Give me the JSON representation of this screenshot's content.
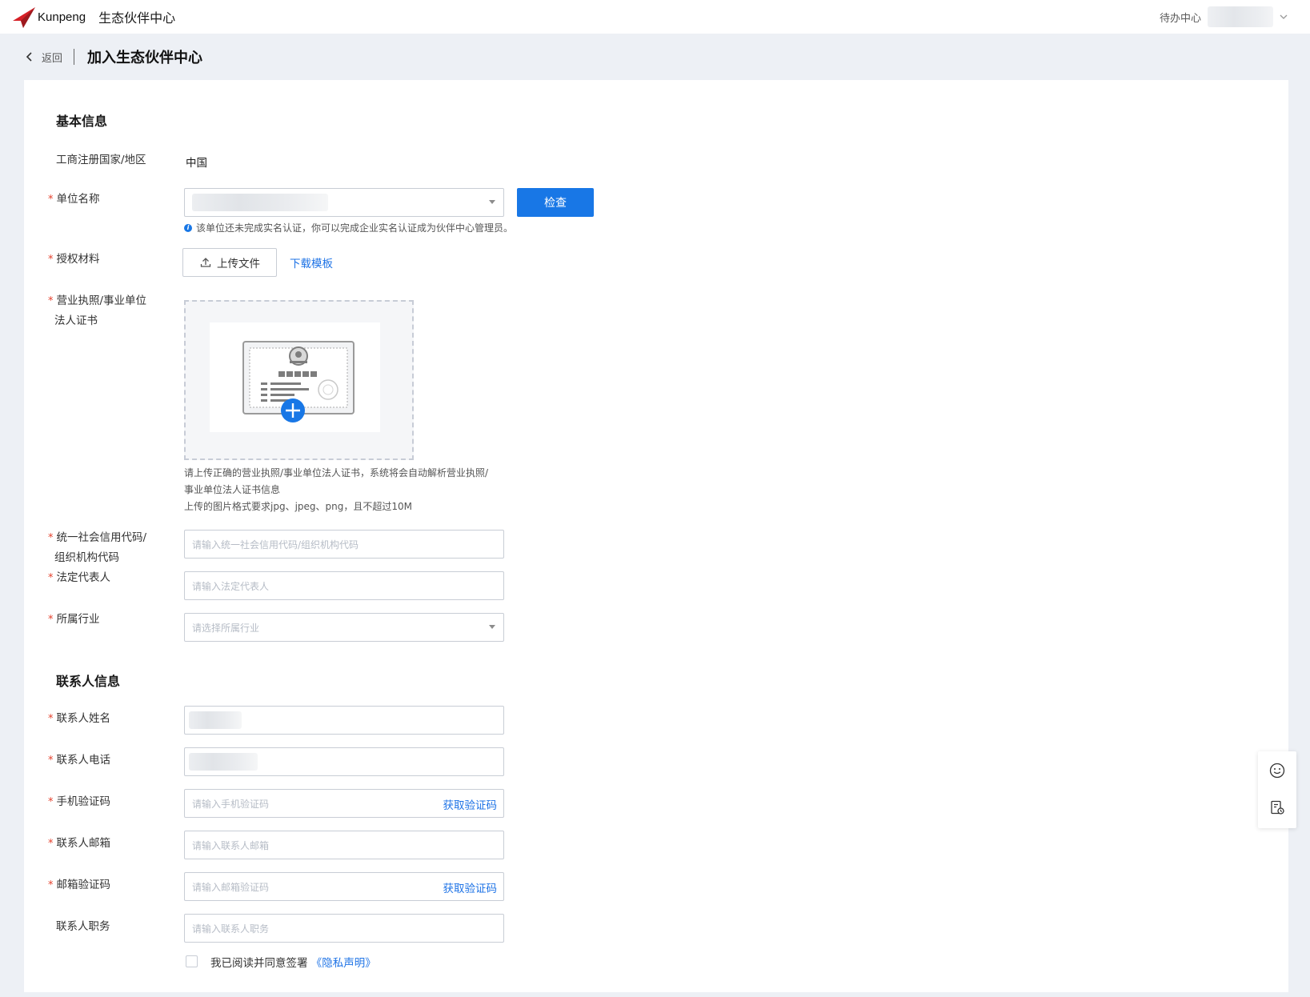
{
  "topbar": {
    "logo_text": "Kunpeng",
    "app_name": "生态伙伴中心",
    "todo": "待办中心"
  },
  "page": {
    "back": "返回",
    "title": "加入生态伙伴中心"
  },
  "basic": {
    "section_title": "基本信息",
    "country": {
      "label": "工商注册国家/地区",
      "value": "中国"
    },
    "unit_name": {
      "label": "单位名称",
      "check_button": "检查",
      "hint": "该单位还未完成实名认证，你可以完成企业实名认证成为伙伴中心管理员。"
    },
    "auth_material": {
      "label": "授权材料",
      "upload_button": "上传文件",
      "download_link": "下载模板"
    },
    "license": {
      "label_line1": "营业执照/事业单位",
      "label_line2": "法人证书",
      "desc_line1": "请上传正确的营业执照/事业单位法人证书，系统将会自动解析营业执照/",
      "desc_line2": "事业单位法人证书信息",
      "desc_line3": "上传的图片格式要求jpg、jpeg、png，且不超过10M"
    },
    "credit_code": {
      "label_line1": "统一社会信用代码/",
      "label_line2": "组织机构代码",
      "placeholder": "请输入统一社会信用代码/组织机构代码"
    },
    "legal_rep": {
      "label": "法定代表人",
      "placeholder": "请输入法定代表人"
    },
    "industry": {
      "label": "所属行业",
      "placeholder": "请选择所属行业"
    }
  },
  "contact": {
    "section_title": "联系人信息",
    "name": {
      "label": "联系人姓名"
    },
    "phone": {
      "label": "联系人电话"
    },
    "sms_code": {
      "label": "手机验证码",
      "placeholder": "请输入手机验证码",
      "action": "获取验证码"
    },
    "email": {
      "label": "联系人邮箱",
      "placeholder": "请输入联系人邮箱"
    },
    "email_code": {
      "label": "邮箱验证码",
      "placeholder": "请输入邮箱验证码",
      "action": "获取验证码"
    },
    "position": {
      "label": "联系人职务",
      "placeholder": "请输入联系人职务"
    },
    "agree_text": "我已阅读并同意签署",
    "privacy_link": "《隐私声明》"
  },
  "required_mark": "*",
  "colors": {
    "primary": "#1877e6",
    "required": "#e5412d",
    "link": "#1e73e6"
  },
  "icons": {
    "float_top": "smiley-icon",
    "float_bottom": "feedback-form-icon"
  }
}
